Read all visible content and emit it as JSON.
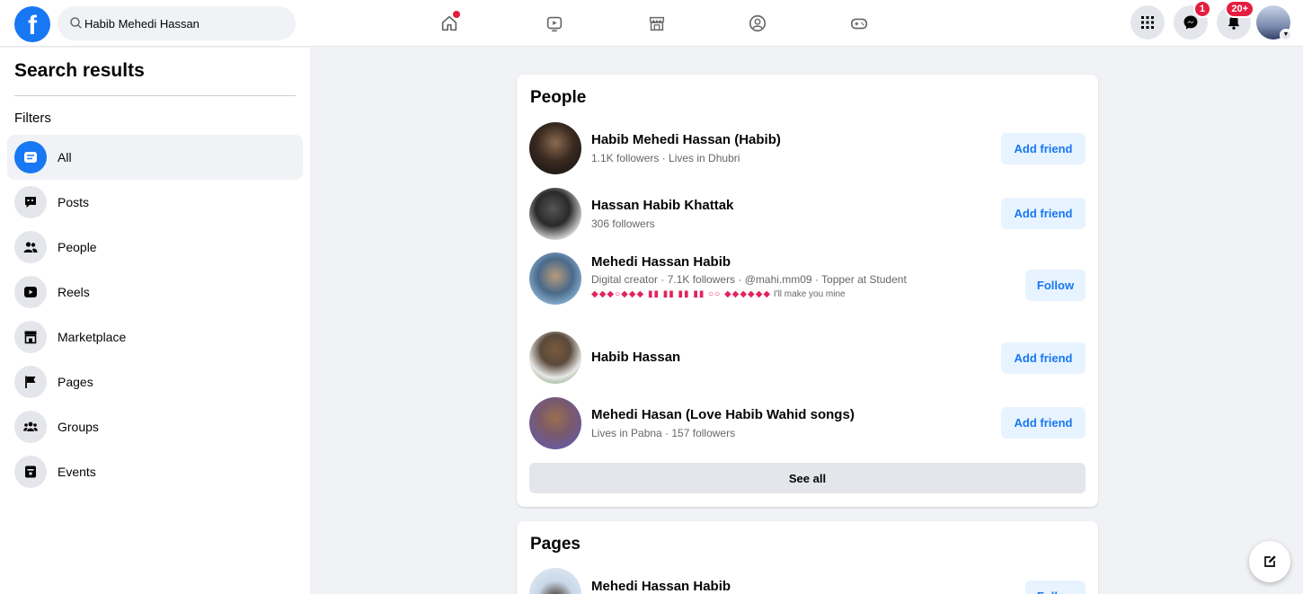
{
  "topbar": {
    "logo": "f",
    "search_value": "Habib Mehedi Hassan",
    "messenger_badge": "1",
    "notifications_badge": "20+"
  },
  "sidebar": {
    "title": "Search results",
    "filters_label": "Filters",
    "items": [
      {
        "label": "All",
        "icon": "all-icon"
      },
      {
        "label": "Posts",
        "icon": "posts-icon"
      },
      {
        "label": "People",
        "icon": "people-icon"
      },
      {
        "label": "Reels",
        "icon": "reels-icon"
      },
      {
        "label": "Marketplace",
        "icon": "marketplace-icon"
      },
      {
        "label": "Pages",
        "icon": "pages-icon"
      },
      {
        "label": "Groups",
        "icon": "groups-icon"
      },
      {
        "label": "Events",
        "icon": "events-icon"
      }
    ]
  },
  "people": {
    "heading": "People",
    "results": [
      {
        "name": "Habib Mehedi Hassan (Habib)",
        "meta": "1.1K followers · Lives in Dhubri",
        "action": "Add friend"
      },
      {
        "name": "Hassan Habib Khattak",
        "meta": "306 followers",
        "action": "Add friend"
      },
      {
        "name": "Mehedi Hassan Habib",
        "meta": "Digital creator · 7.1K followers · @mahi.mm09 · Topper at Student",
        "extra_symbols": "◆◆◆○◆◆◆ ▮▮ ▮▮ ▮▮ ▮▮ ○○ ◆◆◆◆◆◆",
        "extra_text": "I'll make you mine",
        "action": "Follow"
      },
      {
        "name": "Habib Hassan",
        "meta": "",
        "action": "Add friend"
      },
      {
        "name": "Mehedi Hasan (Love Habib Wahid songs)",
        "meta": "Lives in Pabna · 157 followers",
        "action": "Add friend"
      }
    ],
    "see_all": "See all"
  },
  "pages": {
    "heading": "Pages",
    "results": [
      {
        "name": "Mehedi Hassan Habib",
        "action": "Follow"
      }
    ]
  },
  "colors": {
    "accent": "#1877f2",
    "badge": "#e41e3f",
    "button_bg": "#e7f3ff"
  }
}
